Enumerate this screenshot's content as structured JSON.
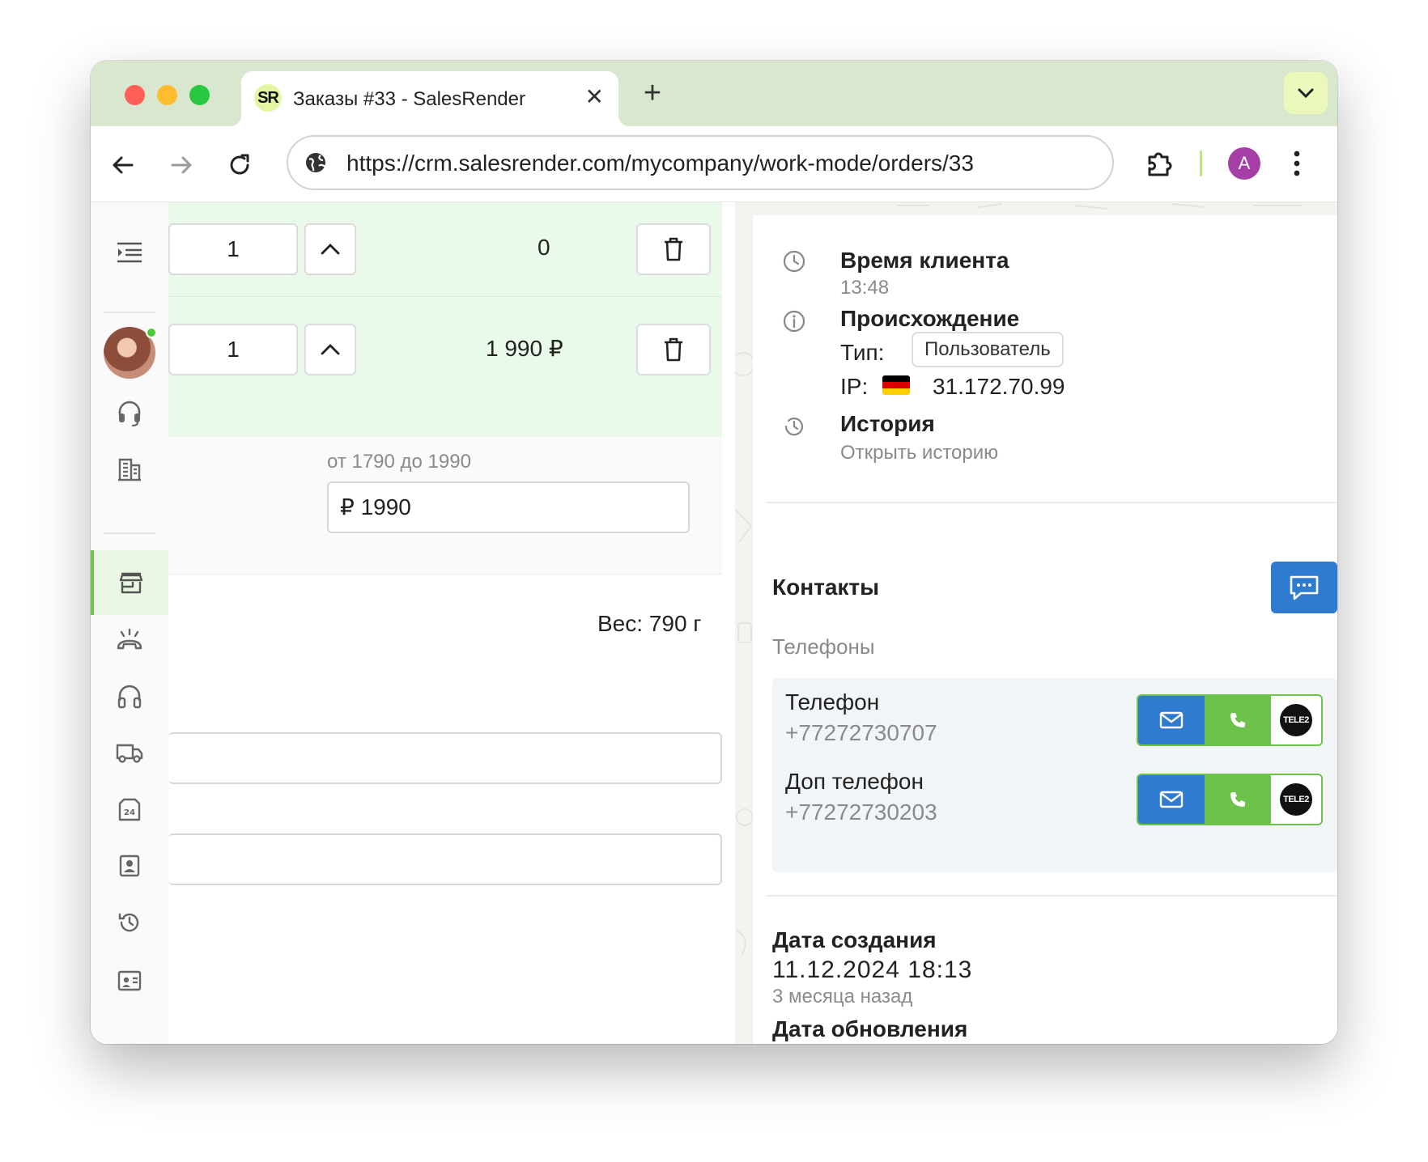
{
  "browser": {
    "tab_favicon": "SR",
    "tab_title": "Заказы #33 - SalesRender",
    "close_glyph": "✕",
    "new_tab_glyph": "+",
    "url": "https://crm.salesrender.com/mycompany/work-mode/orders/33",
    "profile_initial": "A",
    "colors": {
      "tabstrip": "#d9e7cf",
      "profile": "#a53fa6"
    }
  },
  "sidebar": {
    "items": [
      {
        "icon": "menu-indent-icon"
      },
      {
        "icon": "headset-icon"
      },
      {
        "icon": "building-icon"
      },
      {
        "icon": "store-icon",
        "active": true
      },
      {
        "icon": "phone-signal-icon"
      },
      {
        "icon": "headphones-icon"
      },
      {
        "icon": "truck-icon"
      },
      {
        "icon": "warehouse-24-icon"
      },
      {
        "icon": "contact-card-icon"
      },
      {
        "icon": "history-icon"
      },
      {
        "icon": "id-card-icon"
      }
    ]
  },
  "order": {
    "rows": [
      {
        "qty": "1",
        "price": "0"
      },
      {
        "qty": "1",
        "price": "1 990 ₽"
      }
    ],
    "price_range_label": "от 1790 до 1990",
    "price_input_value": "₽ 1990",
    "weight": "Вес: 790 г"
  },
  "panel": {
    "client_time": {
      "title": "Время клиента",
      "value": "13:48"
    },
    "origin": {
      "title": "Происхождение",
      "type_label": "Тип:",
      "type_value": "Пользователь",
      "ip_label": "IP:",
      "ip_value": "31.172.70.99",
      "flag": "germany-flag"
    },
    "history": {
      "title": "История",
      "link": "Открыть историю"
    },
    "contacts": {
      "title": "Контакты",
      "phones_label": "Телефоны",
      "phones": [
        {
          "name": "Телефон",
          "number": "+77272730707",
          "carrier": "TELE2"
        },
        {
          "name": "Доп телефон",
          "number": "+77272730203",
          "carrier": "TELE2"
        }
      ]
    },
    "created": {
      "title": "Дата создания",
      "value": "11.12.2024 18:13",
      "relative": "3 месяца назад"
    },
    "updated": {
      "title": "Дата обновления"
    },
    "colors": {
      "primary": "#2f7bd0",
      "success": "#6cc24a",
      "accent_bg": "#eafaea"
    }
  }
}
